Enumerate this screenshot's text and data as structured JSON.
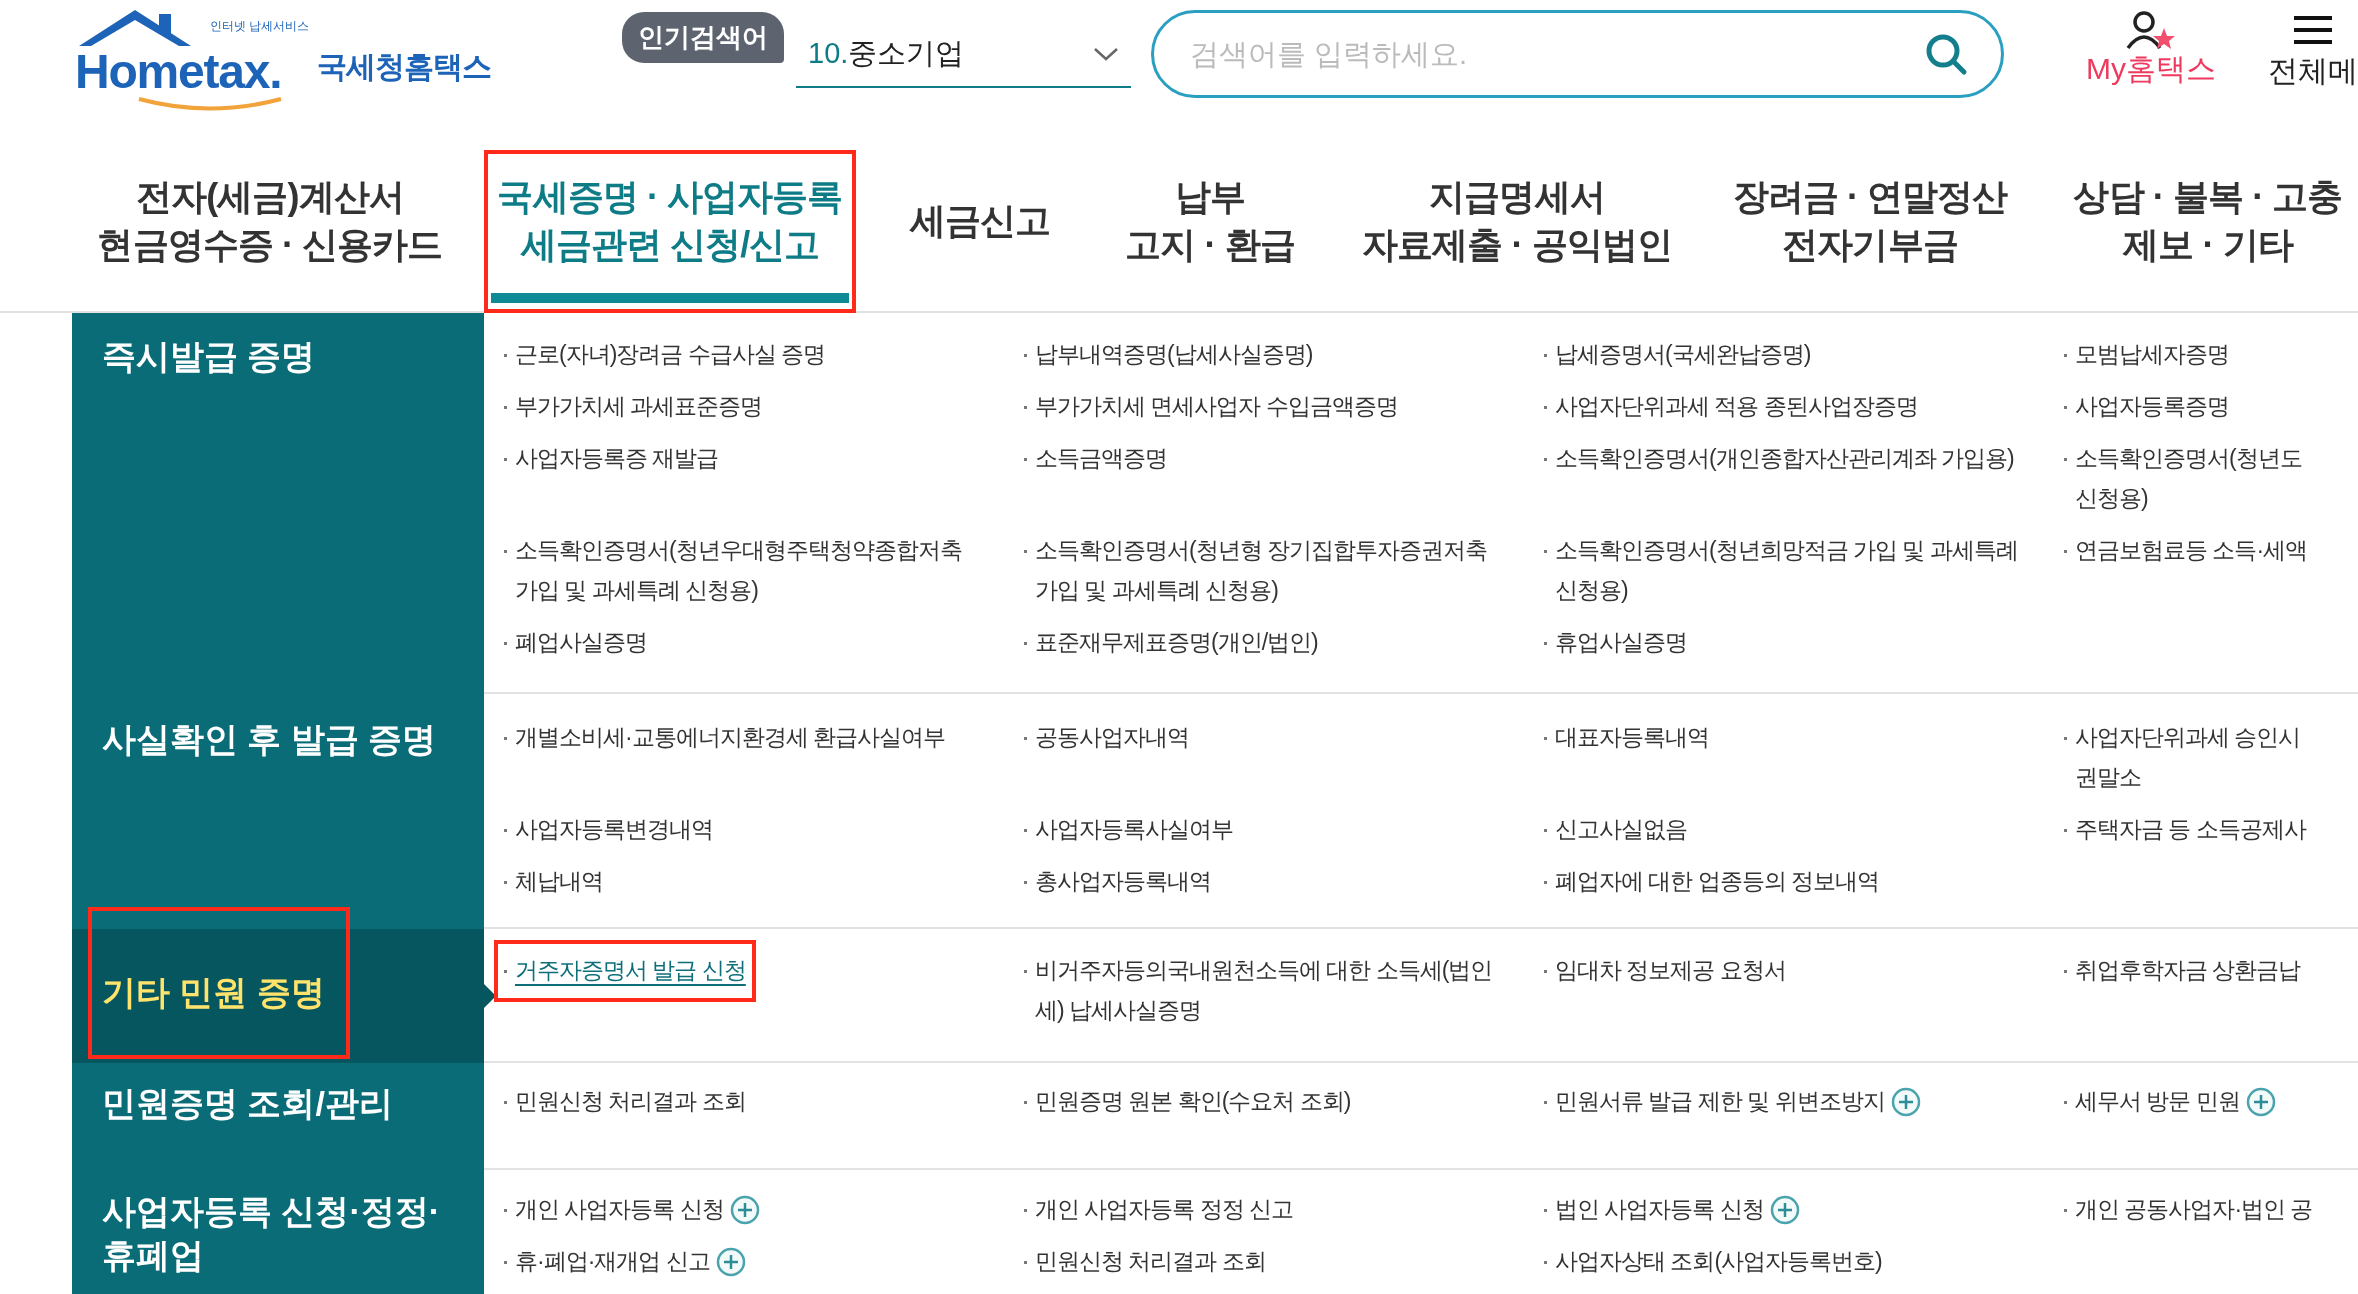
{
  "header": {
    "logo": {
      "tagline": "인터넷 납세서비스",
      "wordmark": "Hometax.",
      "name": "국세청홈택스"
    },
    "popular": {
      "badge": "인기검색어",
      "rank": "10.",
      "term": "중소기업"
    },
    "search": {
      "placeholder": "검색어를 입력하세요."
    },
    "my_link": "My홈택스",
    "menu_label": "전체메"
  },
  "nav_tabs": [
    {
      "label": "전자(세금)계산서\n현금영수증 · 신용카드",
      "selected": false,
      "marked": false
    },
    {
      "label": "국세증명 · 사업자등록\n세금관련 신청/신고",
      "selected": true,
      "marked": true
    },
    {
      "label": "세금신고",
      "selected": false,
      "marked": false
    },
    {
      "label": "납부\n고지 · 환급",
      "selected": false,
      "marked": false
    },
    {
      "label": "지급명세서\n자료제출 · 공익법인",
      "selected": false,
      "marked": false
    },
    {
      "label": "장려금 · 연말정산\n전자기부금",
      "selected": false,
      "marked": false
    },
    {
      "label": "상담 · 불복 · 고충\n제보 · 기타",
      "selected": false,
      "marked": false
    }
  ],
  "sections": [
    {
      "title": "즉시발급 증명",
      "selected": false,
      "items": [
        {
          "text": "근로(자녀)장려금 수급사실 증명"
        },
        {
          "text": "납부내역증명(납세사실증명)"
        },
        {
          "text": "납세증명서(국세완납증명)"
        },
        {
          "text": "모범납세자증명"
        },
        {
          "text": "부가가치세 과세표준증명"
        },
        {
          "text": "부가가치세 면세사업자 수입금액증명"
        },
        {
          "text": "사업자단위과세 적용 종된사업장증명"
        },
        {
          "text": "사업자등록증명"
        },
        {
          "text": "사업자등록증 재발급"
        },
        {
          "text": "소득금액증명"
        },
        {
          "text": "소득확인증명서(개인종합자산관리계좌 가입용)"
        },
        {
          "text": "소득확인증명서(청년도\n신청용)"
        },
        {
          "text": "소득확인증명서(청년우대형주택청약종합저축\n가입 및 과세특례 신청용)"
        },
        {
          "text": "소득확인증명서(청년형 장기집합투자증권저축\n가입 및 과세특례 신청용)"
        },
        {
          "text": "소득확인증명서(청년희망적금 가입 및 과세특례\n신청용)"
        },
        {
          "text": "연금보험료등 소득·세액"
        },
        {
          "text": "폐업사실증명"
        },
        {
          "text": "표준재무제표증명(개인/법인)"
        },
        {
          "text": "휴업사실증명"
        }
      ]
    },
    {
      "title": "사실확인 후 발급 증명",
      "selected": false,
      "items": [
        {
          "text": "개별소비세·교통에너지환경세 환급사실여부"
        },
        {
          "text": "공동사업자내역"
        },
        {
          "text": "대표자등록내역"
        },
        {
          "text": "사업자단위과세 승인시\n권말소"
        },
        {
          "text": "사업자등록변경내역"
        },
        {
          "text": "사업자등록사실여부"
        },
        {
          "text": "신고사실없음"
        },
        {
          "text": "주택자금 등 소득공제사"
        },
        {
          "text": "체납내역"
        },
        {
          "text": "총사업자등록내역"
        },
        {
          "text": "폐업자에 대한 업종등의 정보내역"
        }
      ]
    },
    {
      "title": "기타 민원 증명",
      "selected": true,
      "marked": true,
      "items": [
        {
          "text": "거주자증명서 발급 신청",
          "kind": "link",
          "marked": true
        },
        {
          "text": "비거주자등의국내원천소득에 대한 소득세(법인\n세) 납세사실증명",
          "kind": "plain"
        },
        {
          "text": "임대차 정보제공 요청서",
          "kind": "plain"
        },
        {
          "text": "취업후학자금 상환금납",
          "kind": "plain"
        }
      ]
    },
    {
      "title": "민원증명 조회/관리",
      "selected": false,
      "items": [
        {
          "text": "민원신청 처리결과 조회"
        },
        {
          "text": "민원증명 원본 확인(수요처 조회)"
        },
        {
          "text": "민원서류 발급 제한 및 위변조방지",
          "add_button": true
        },
        {
          "text": "세무서 방문 민원",
          "add_button": true
        }
      ]
    },
    {
      "title": "사업자등록 신청·정정·\n휴폐업",
      "selected": false,
      "items": [
        {
          "text": "개인 사업자등록 신청",
          "add_button": true
        },
        {
          "text": "개인 사업자등록 정정 신고"
        },
        {
          "text": "법인 사업자등록 신청",
          "add_button": true
        },
        {
          "text": "개인 공동사업자·법인 공"
        },
        {
          "text": "휴·폐업·재개업 신고",
          "add_button": true
        },
        {
          "text": "민원신청 처리결과 조회"
        },
        {
          "text": "사업자상태 조회(사업자등록번호)"
        }
      ]
    }
  ]
}
